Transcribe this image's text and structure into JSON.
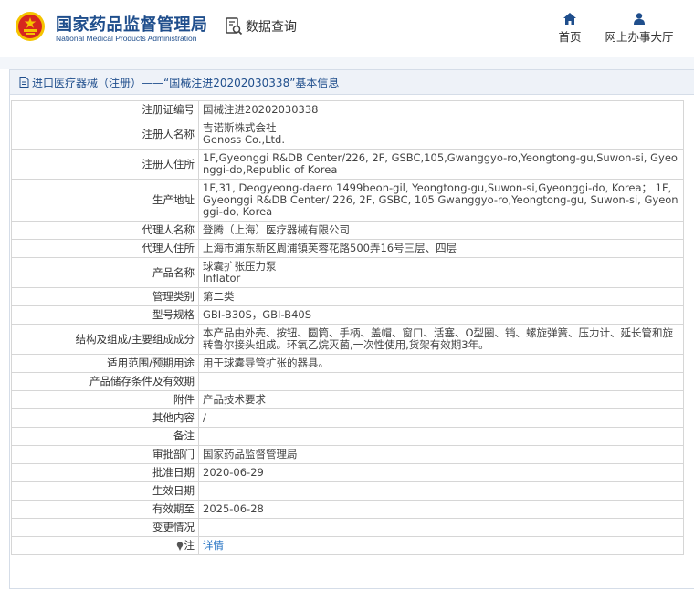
{
  "header": {
    "logo_cn": "国家药品监督管理局",
    "logo_en": "National Medical Products Administration",
    "query_label": "数据查询",
    "nav": [
      {
        "label": "首页",
        "icon": "home-icon"
      },
      {
        "label": "网上办事大厅",
        "icon": "user-icon"
      }
    ]
  },
  "breadcrumb": {
    "text": "进口医疗器械（注册）——“国械注进20202030338”基本信息",
    "icon": "document-icon"
  },
  "rows": [
    {
      "key": "注册证编号",
      "value": [
        "国械注进20202030338"
      ]
    },
    {
      "key": "注册人名称",
      "value": [
        "吉诺斯株式会社",
        "Genoss Co.,Ltd."
      ]
    },
    {
      "key": "注册人住所",
      "value": [
        "1F,Gyeonggi R&DB Center/226, 2F, GSBC,105,Gwanggyo-ro,Yeongtong-gu,Suwon-si, Gyeonggi-do,Republic of Korea"
      ]
    },
    {
      "key": "生产地址",
      "value": [
        "1F,31, Deogyeong-daero 1499beon-gil, Yeongtong-gu,Suwon-si,Gyeonggi-do, Korea； 1F, Gyeonggi R&DB Center/ 226, 2F, GSBC, 105 Gwanggyo-ro,Yeongtong-gu, Suwon-si, Gyeonggi-do, Korea"
      ]
    },
    {
      "key": "代理人名称",
      "value": [
        "登腾（上海）医疗器械有限公司"
      ]
    },
    {
      "key": "代理人住所",
      "value": [
        "上海市浦东新区周浦镇芙蓉花路500弄16号三层、四层"
      ]
    },
    {
      "key": "产品名称",
      "value": [
        "球囊扩张压力泵",
        "Inflator"
      ]
    },
    {
      "key": "管理类别",
      "value": [
        "第二类"
      ]
    },
    {
      "key": "型号规格",
      "value": [
        "GBI-B30S，GBI-B40S"
      ]
    },
    {
      "key": "结构及组成/主要组成成分",
      "value": [
        "本产品由外壳、按钮、圆筒、手柄、盖帽、窗口、活塞、O型圈、销、螺旋弹簧、压力计、延长管和旋转鲁尔接头组成。环氧乙烷灭菌,一次性使用,货架有效期3年。"
      ]
    },
    {
      "key": "适用范围/预期用途",
      "value": [
        "用于球囊导管扩张的器具。"
      ]
    },
    {
      "key": "产品储存条件及有效期",
      "value": [
        ""
      ]
    },
    {
      "key": "附件",
      "value": [
        "产品技术要求"
      ]
    },
    {
      "key": "其他内容",
      "value": [
        "/"
      ]
    },
    {
      "key": "备注",
      "value": [
        ""
      ]
    },
    {
      "key": "审批部门",
      "value": [
        "国家药品监督管理局"
      ]
    },
    {
      "key": "批准日期",
      "value": [
        "2020-06-29"
      ]
    },
    {
      "key": "生效日期",
      "value": [
        ""
      ]
    },
    {
      "key": "有效期至",
      "value": [
        "2025-06-28"
      ]
    },
    {
      "key": "变更情况",
      "value": [
        ""
      ]
    },
    {
      "key": "注",
      "value": [
        "详情"
      ],
      "key_icon": "pin-icon",
      "link": true
    }
  ],
  "colors": {
    "brand_blue": "#1f4e8c",
    "link": "#1f6fc2",
    "emblem_red": "#d7261e",
    "emblem_gold": "#f5c400"
  }
}
